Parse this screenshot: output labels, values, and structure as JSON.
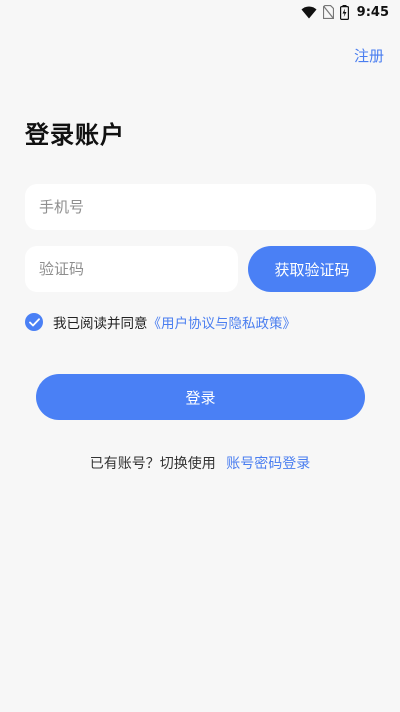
{
  "status_bar": {
    "time": "9:45",
    "icons": [
      "wifi-icon",
      "no-sim-icon",
      "battery-charging-icon"
    ]
  },
  "header": {
    "register_label": "注册"
  },
  "main": {
    "title": "登录账户",
    "phone_placeholder": "手机号",
    "phone_value": "",
    "code_placeholder": "验证码",
    "code_value": "",
    "get_code_label": "获取验证码",
    "agree": {
      "checked": true,
      "prefix": "我已阅读并同意",
      "policy_link": "《用户协议与隐私政策》"
    },
    "login_label": "登录",
    "switch": {
      "prefix": "已有账号？切换使用",
      "link": "账号密码登录"
    }
  },
  "colors": {
    "accent": "#4a80f5",
    "link": "#4a7ef0",
    "background": "#f7f7f7"
  }
}
